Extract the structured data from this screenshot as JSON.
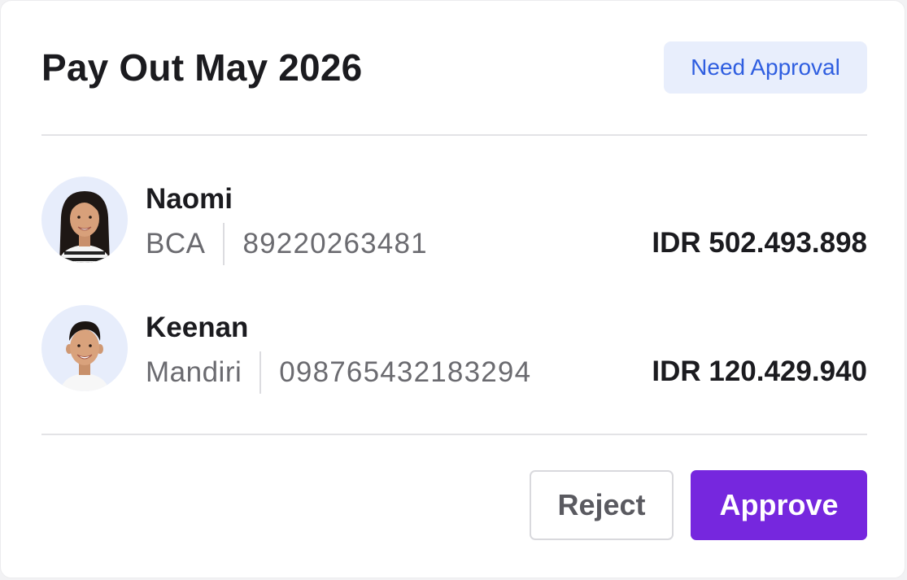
{
  "header": {
    "title": "Pay Out May 2026",
    "status_badge": "Need Approval"
  },
  "payees": [
    {
      "name": "Naomi",
      "bank": "BCA",
      "account": "89220263481",
      "amount": "IDR 502.493.898",
      "avatar_icon": "woman-avatar-icon"
    },
    {
      "name": "Keenan",
      "bank": "Mandiri",
      "account": "098765432183294",
      "amount": "IDR 120.429.940",
      "avatar_icon": "man-avatar-icon"
    }
  ],
  "actions": {
    "reject_label": "Reject",
    "approve_label": "Approve"
  },
  "colors": {
    "accent": "#7627de",
    "badge_bg": "#e8eefc",
    "badge_text": "#2f5ee0",
    "avatar_bg": "#e7edfb"
  }
}
